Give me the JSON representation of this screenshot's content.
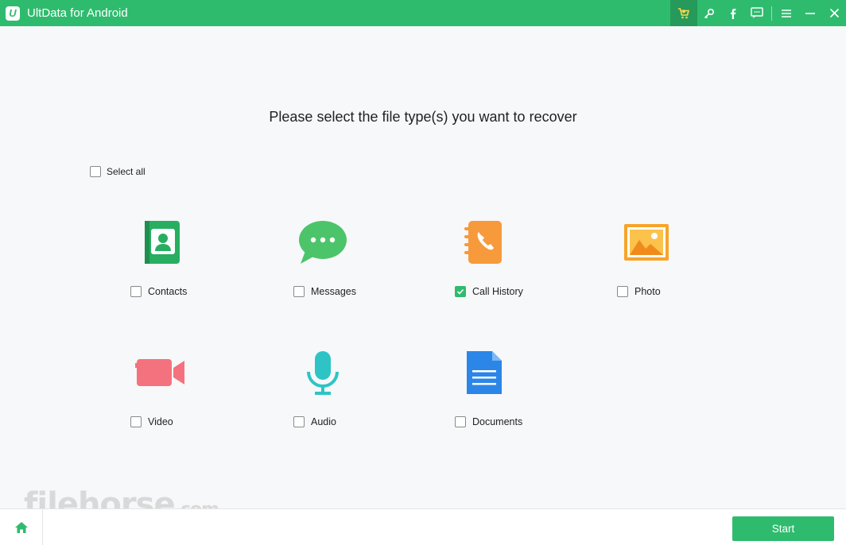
{
  "window": {
    "title": "UltData for Android",
    "logo_letter": "U"
  },
  "toolbar": {
    "icons": [
      "cart-icon",
      "key-icon",
      "facebook-icon",
      "feedback-icon",
      "menu-icon",
      "minimize-icon",
      "close-icon"
    ]
  },
  "main": {
    "heading": "Please select the file type(s) you want to recover",
    "select_all": {
      "label": "Select all",
      "checked": false
    },
    "file_types": [
      {
        "label": "Contacts",
        "icon": "contacts-icon",
        "checked": false
      },
      {
        "label": "Messages",
        "icon": "messages-icon",
        "checked": false
      },
      {
        "label": "Call History",
        "icon": "call-history-icon",
        "checked": true
      },
      {
        "label": "Photo",
        "icon": "photo-icon",
        "checked": false
      },
      {
        "label": "Video",
        "icon": "video-icon",
        "checked": false
      },
      {
        "label": "Audio",
        "icon": "audio-icon",
        "checked": false
      },
      {
        "label": "Documents",
        "icon": "documents-icon",
        "checked": false
      }
    ]
  },
  "footer": {
    "start_label": "Start"
  },
  "watermark": {
    "text": "filehorse",
    "suffix": ".com"
  },
  "colors": {
    "accent": "#2fbb6e",
    "background": "#f7f8fa"
  }
}
